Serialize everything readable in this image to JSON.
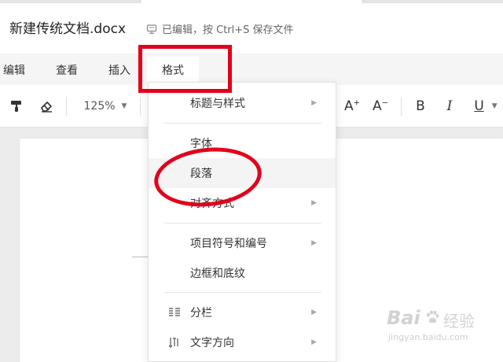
{
  "titlebar": {
    "document_name": "新建传统文档.docx",
    "save_status": "已编辑，按 Ctrl+S 保存文件",
    "save_icon": "monitor-save-icon"
  },
  "menubar": {
    "items": [
      "编辑",
      "查看",
      "插入",
      "格式"
    ],
    "active": "格式"
  },
  "toolbar": {
    "zoom": "125%",
    "font_size_increase": "A",
    "font_size_decrease": "A",
    "bold": "B",
    "italic": "I",
    "underline": "U",
    "icons": [
      "format-painter-icon",
      "eraser-icon",
      "chevron-down-icon",
      "font-size-increase-icon",
      "font-size-decrease-icon",
      "bold-icon",
      "italic-icon",
      "underline-icon"
    ]
  },
  "format_menu": {
    "items": [
      {
        "label": "标题与样式",
        "has_submenu": true
      },
      {
        "label": "字体",
        "has_submenu": false
      },
      {
        "label": "段落",
        "has_submenu": false,
        "highlighted": true
      },
      {
        "label": "对齐方式",
        "has_submenu": true
      },
      {
        "label": "项目符号和编号",
        "has_submenu": true
      },
      {
        "label": "边框和底纹",
        "has_submenu": false
      },
      {
        "label": "分栏",
        "has_submenu": true,
        "icon": "columns-icon"
      },
      {
        "label": "文字方向",
        "has_submenu": true,
        "icon": "text-direction-icon"
      }
    ]
  },
  "annotations": {
    "color": "#e3001b"
  },
  "watermark": {
    "brand_left": "Bai",
    "brand_right": "经验",
    "url": "jingyan.baidu.com"
  },
  "colors": {
    "menubar_bg": "#f5f5f5",
    "canvas_bg": "#ececec",
    "highlight": "#f4f4f4"
  }
}
